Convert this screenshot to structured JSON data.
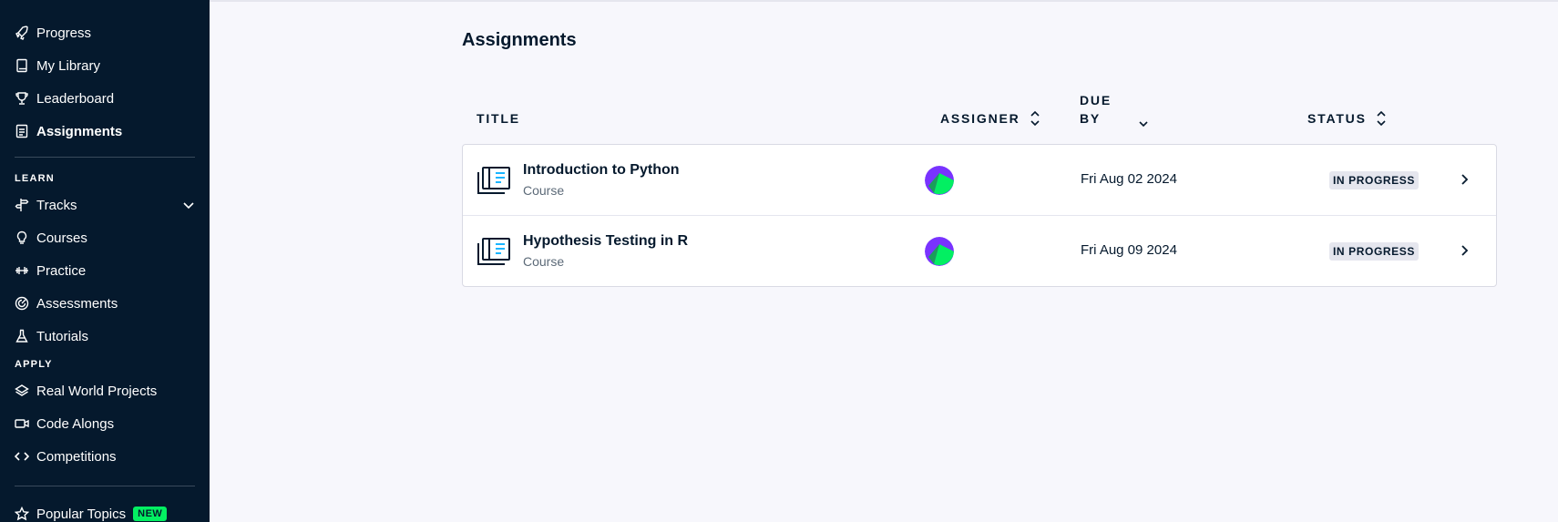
{
  "sidebar": {
    "items_top": [
      {
        "label": "Progress",
        "icon": "rocket-icon"
      },
      {
        "label": "My Library",
        "icon": "book-icon"
      },
      {
        "label": "Leaderboard",
        "icon": "trophy-icon"
      },
      {
        "label": "Assignments",
        "icon": "clipboard-icon",
        "active": true
      }
    ],
    "learn_label": "LEARN",
    "learn_items": [
      {
        "label": "Tracks",
        "icon": "signpost-icon"
      },
      {
        "label": "Courses",
        "icon": "lightbulb-icon"
      },
      {
        "label": "Practice",
        "icon": "dumbbell-icon"
      },
      {
        "label": "Assessments",
        "icon": "radar-icon"
      },
      {
        "label": "Tutorials",
        "icon": "flask-icon"
      }
    ],
    "apply_label": "APPLY",
    "apply_items": [
      {
        "label": "Real World Projects",
        "icon": "layers-icon"
      },
      {
        "label": "Code Alongs",
        "icon": "video-icon"
      },
      {
        "label": "Competitions",
        "icon": "code-icon"
      }
    ],
    "popular": {
      "label": "Popular Topics",
      "badge": "NEW",
      "icon": "star-icon"
    }
  },
  "page": {
    "title": "Assignments"
  },
  "table": {
    "headers": {
      "title": "TITLE",
      "assigner": "ASSIGNER",
      "due_line1": "DUE",
      "due_line2": "BY",
      "status": "STATUS"
    },
    "rows": [
      {
        "title": "Introduction to Python",
        "type": "Course",
        "due": "Fri Aug 02 2024",
        "status": "IN PROGRESS"
      },
      {
        "title": "Hypothesis Testing in R",
        "type": "Course",
        "due": "Fri Aug 09 2024",
        "status": "IN PROGRESS"
      }
    ]
  },
  "colors": {
    "sidebar_bg": "#05192d",
    "page_bg": "#f7f7fc",
    "accent_green": "#03ef62",
    "avatar_purple": "#7933ff"
  }
}
